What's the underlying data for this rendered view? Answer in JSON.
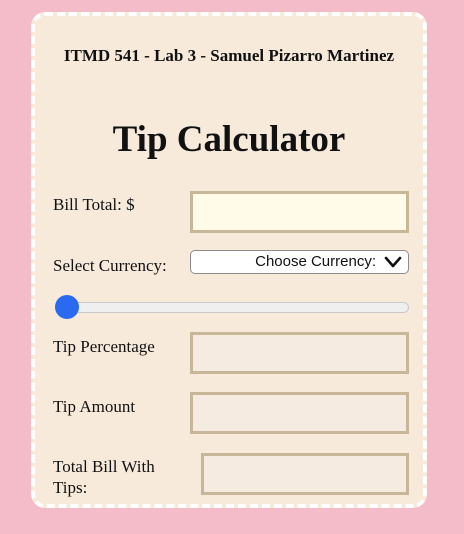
{
  "header": {
    "text": "ITMD 541 - Lab 3 - Samuel Pizarro Martinez"
  },
  "app": {
    "title": "Tip Calculator"
  },
  "form": {
    "bill_total_label": "Bill Total: $",
    "bill_total_value": "",
    "currency_label": "Select Currency:",
    "currency_selected": "Choose Currency:",
    "slider": {
      "min": 0,
      "max": 100,
      "value": 0
    },
    "tip_percentage_label": "Tip Percentage",
    "tip_percentage_value": "",
    "tip_amount_label": "Tip Amount",
    "tip_amount_value": "",
    "total_label_line1": "Total Bill With",
    "total_label_line2": "Tips:",
    "total_value": ""
  },
  "colors": {
    "page_background": "#f3bcc8",
    "card_background": "#f8eadb",
    "card_border": "#ffffff",
    "field_border": "#c7b698",
    "slider_thumb": "#2a6af1"
  },
  "icons": {
    "select_arrow": "chevron-down-icon"
  }
}
